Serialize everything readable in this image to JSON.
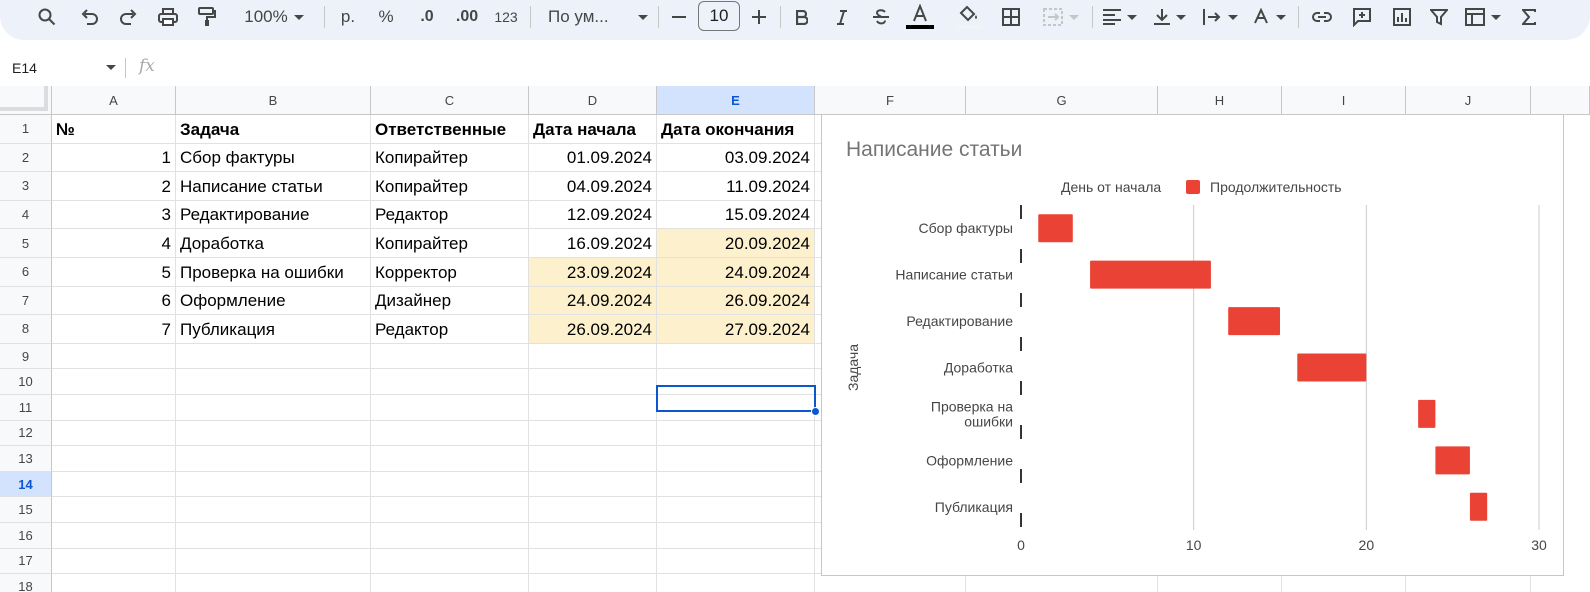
{
  "toolbar": {
    "zoom": "100%",
    "currency": "р.",
    "percent": "%",
    "dec_decrease": ".0",
    "dec_increase": ".00",
    "number_format": "123",
    "font_name": "По ум...",
    "font_size": "10"
  },
  "formula_bar": {
    "name_box": "E14",
    "fx": "fx",
    "value": ""
  },
  "columns": [
    "A",
    "B",
    "C",
    "D",
    "E",
    "F",
    "G",
    "H",
    "I",
    "J"
  ],
  "selected_column": "E",
  "row_numbers": [
    "1",
    "2",
    "3",
    "4",
    "5",
    "6",
    "7",
    "8",
    "9",
    "10",
    "11",
    "12",
    "13",
    "14",
    "15",
    "16",
    "17",
    "18"
  ],
  "selected_row": "14",
  "table": {
    "headers": [
      "№",
      "Задача",
      "Ответственные",
      "Дата начала",
      "Дата окончания"
    ],
    "rows": [
      [
        "1",
        "Сбор фактуры",
        "Копирайтер",
        "01.09.2024",
        "03.09.2024"
      ],
      [
        "2",
        "Написание статьи",
        "Копирайтер",
        "04.09.2024",
        "11.09.2024"
      ],
      [
        "3",
        "Редактирование",
        "Редактор",
        "12.09.2024",
        "15.09.2024"
      ],
      [
        "4",
        "Доработка",
        "Копирайтер",
        "16.09.2024",
        "20.09.2024"
      ],
      [
        "5",
        "Проверка на ошибки",
        "Корректор",
        "23.09.2024",
        "24.09.2024"
      ],
      [
        "6",
        "Оформление",
        "Дизайнер",
        "24.09.2024",
        "26.09.2024"
      ],
      [
        "7",
        "Публикация",
        "Редактор",
        "26.09.2024",
        "27.09.2024"
      ]
    ]
  },
  "highlight_color": "#fdf0cc",
  "accent_color": "#0b57d0",
  "chart_data": {
    "type": "bar",
    "orientation": "horizontal",
    "stacked": true,
    "title": "Написание статьи",
    "ylabel": "Задача",
    "xlabel": "",
    "xlim": [
      0,
      30
    ],
    "xticks": [
      0,
      10,
      20,
      30
    ],
    "grid": true,
    "legend_position": "top",
    "categories": [
      "Сбор фактуры",
      "Написание статьи",
      "Редактирование",
      "Доработка",
      "Проверка на ошибки",
      "Оформление",
      "Публикация"
    ],
    "category_lines": [
      [
        "Сбор фактуры"
      ],
      [
        "Написание статьи"
      ],
      [
        "Редактирование"
      ],
      [
        "Доработка"
      ],
      [
        "Проверка на",
        "ошибки"
      ],
      [
        "Оформление"
      ],
      [
        "Публикация"
      ]
    ],
    "series": [
      {
        "name": "День от начала",
        "values": [
          1,
          4,
          12,
          16,
          23,
          24,
          26
        ],
        "color": "transparent"
      },
      {
        "name": "Продолжительность",
        "values": [
          2,
          7,
          3,
          4,
          1,
          2,
          1
        ],
        "color": "#ea4335"
      }
    ]
  }
}
